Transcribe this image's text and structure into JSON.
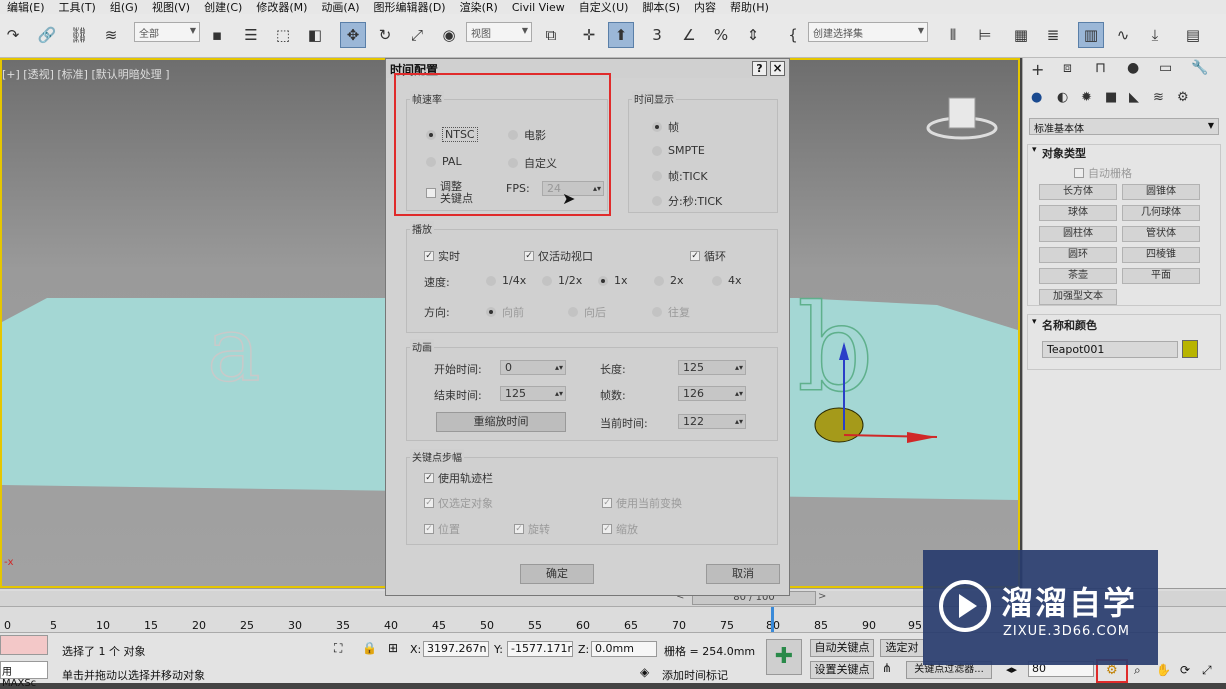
{
  "menubar": [
    "编辑(E)",
    "工具(T)",
    "组(G)",
    "视图(V)",
    "创建(C)",
    "修改器(M)",
    "动画(A)",
    "图形编辑器(D)",
    "渲染(R)",
    "Civil View",
    "自定义(U)",
    "脚本(S)",
    "内容",
    "帮助(H)"
  ],
  "toolbar": {
    "filter_value": "全部",
    "view_value": "视图",
    "selection_set": "创建选择集"
  },
  "viewport": {
    "label": "[+] [透视] [标准] [默认明暗处理 ]"
  },
  "dialog": {
    "title": "时间配置",
    "help_btn": "?",
    "close_btn": "×",
    "frame_rate": {
      "title": "帧速率",
      "ntsc": "NTSC",
      "film": "电影",
      "pal": "PAL",
      "custom": "自定义",
      "adjust_keys": "调整\n关键点",
      "fps_label": "FPS:",
      "fps_value": "24"
    },
    "time_display": {
      "title": "时间显示",
      "frames": "帧",
      "smpte": "SMPTE",
      "frame_tick": "帧:TICK",
      "mmss_tick": "分:秒:TICK"
    },
    "playback": {
      "title": "播放",
      "realtime": "实时",
      "active_viewport": "仅活动视口",
      "loop": "循环",
      "speed_label": "速度:",
      "speeds": [
        "1/4x",
        "1/2x",
        "1x",
        "2x",
        "4x"
      ],
      "direction_label": "方向:",
      "directions": [
        "向前",
        "向后",
        "往复"
      ]
    },
    "animation": {
      "title": "动画",
      "start_label": "开始时间:",
      "start_value": "0",
      "end_label": "结束时间:",
      "end_value": "125",
      "length_label": "长度:",
      "length_value": "125",
      "frames_label": "帧数:",
      "frames_value": "126",
      "rescale_btn": "重缩放时间",
      "current_label": "当前时间:",
      "current_value": "122"
    },
    "key_steps": {
      "title": "关键点步幅",
      "use_trackbar": "使用轨迹栏",
      "selected_only": "仅选定对象",
      "use_current_transform": "使用当前变换",
      "position": "位置",
      "rotation": "旋转",
      "scale": "缩放"
    },
    "ok": "确定",
    "cancel": "取消"
  },
  "right_panel": {
    "category": "标准基本体",
    "object_type_title": "对象类型",
    "autogrid": "自动栅格",
    "buttons": [
      "长方体",
      "圆锥体",
      "球体",
      "几何球体",
      "圆柱体",
      "管状体",
      "圆环",
      "四棱锥",
      "茶壶",
      "平面",
      "加强型文本"
    ],
    "name_color_title": "名称和颜色",
    "object_name": "Teapot001",
    "object_color": "#b8b400"
  },
  "timeline": {
    "ticks": [
      "0",
      "5",
      "10",
      "15",
      "20",
      "25",
      "30",
      "35",
      "40",
      "45",
      "50",
      "55",
      "60",
      "65",
      "70",
      "75",
      "80",
      "85",
      "90",
      "95"
    ],
    "slider": "80 / 100"
  },
  "status": {
    "maxscript": "用 MAXSc",
    "selected": "选择了 1 个 对象",
    "prompt": "单击并拖动以选择并移动对象",
    "x_label": "X:",
    "x_value": "3197.267n",
    "y_label": "Y:",
    "y_value": "-1577.171r",
    "z_label": "Z:",
    "z_value": "0.0mm",
    "grid": "栅格 = 254.0mm",
    "add_time_tag": "添加时间标记",
    "auto_key": "自动关键点",
    "set_key": "设置关键点",
    "selected_obj": "选定对",
    "key_filters": "关键点过滤器...",
    "frame_value": "80"
  },
  "watermark": {
    "brand": "溜溜自学",
    "url": "ZIXUE.3D66.COM"
  }
}
